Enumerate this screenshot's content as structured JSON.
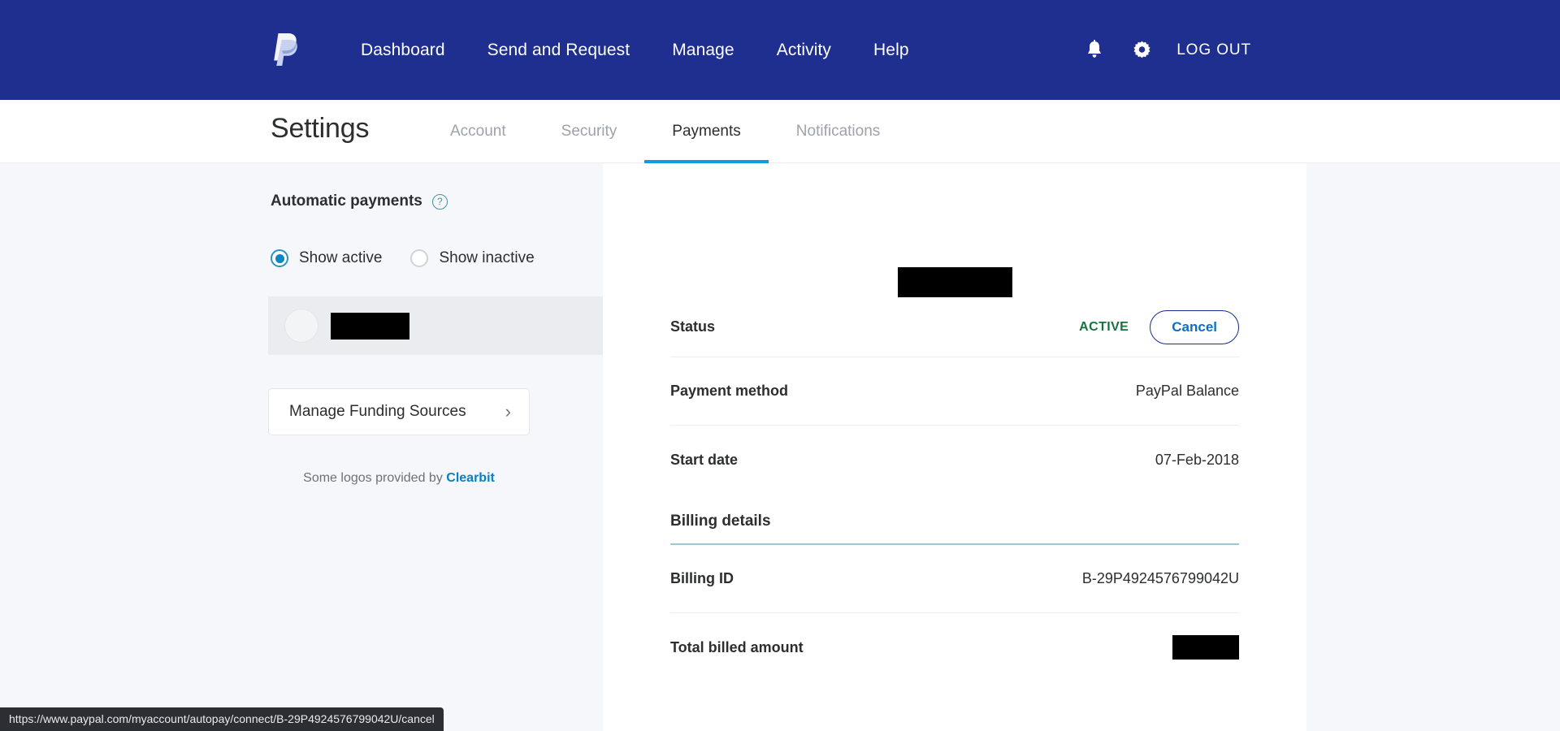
{
  "topnav": {
    "logo_icon": "paypal-logo-icon",
    "links": [
      {
        "label": "Dashboard"
      },
      {
        "label": "Send and Request"
      },
      {
        "label": "Manage"
      },
      {
        "label": "Activity"
      },
      {
        "label": "Help"
      }
    ],
    "bell_icon": "notification-bell-icon",
    "gear_icon": "settings-gear-icon",
    "logout_label": "LOG OUT",
    "background_color": "#1e2f8f"
  },
  "settings": {
    "title": "Settings",
    "tabs": [
      {
        "label": "Account",
        "active": false
      },
      {
        "label": "Security",
        "active": false
      },
      {
        "label": "Payments",
        "active": true
      },
      {
        "label": "Notifications",
        "active": false
      }
    ],
    "active_tab_underline_color": "#0d9ddb"
  },
  "sidebar": {
    "heading": "Automatic payments",
    "help_icon": "help-question-icon",
    "filters": [
      {
        "label": "Show active",
        "selected": true
      },
      {
        "label": "Show inactive",
        "selected": false
      }
    ],
    "agreement": {
      "avatar_icon": "merchant-avatar-icon",
      "name": "",
      "name_redacted": true,
      "selected": true
    },
    "funding_card": {
      "label": "Manage Funding Sources",
      "chevron_icon": "chevron-right-icon"
    },
    "attribution": {
      "prefix": "Some logos provided by ",
      "link": "Clearbit",
      "link_color": "#0c7fc1"
    }
  },
  "detail": {
    "merchant_title_redacted": true,
    "rows": [
      {
        "label": "Status",
        "value": "ACTIVE",
        "action": "Cancel"
      },
      {
        "label": "Payment method",
        "value": "PayPal Balance"
      },
      {
        "label": "Start date",
        "value": "07-Feb-2018"
      }
    ],
    "status_value_color": "#15733e",
    "cancel_label": "Cancel",
    "billing": {
      "heading": "Billing details",
      "rows": [
        {
          "label": "Billing ID",
          "value": "B-29P4924576799042U"
        },
        {
          "label": "Total billed amount",
          "value": "",
          "redacted": true
        }
      ]
    }
  },
  "statusbar": {
    "url": "https://www.paypal.com/myaccount/autopay/connect/B-29P4924576799042U/cancel"
  }
}
